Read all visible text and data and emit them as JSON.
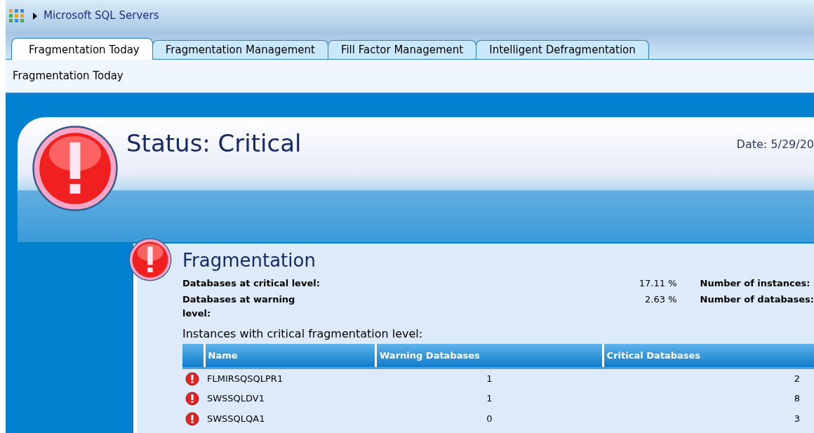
{
  "breadcrumb": {
    "title": "Microsoft SQL Servers"
  },
  "tabs": [
    {
      "label": "Fragmentation Today",
      "selected": true
    },
    {
      "label": "Fragmentation Management",
      "selected": false
    },
    {
      "label": "Fill Factor Management",
      "selected": false
    },
    {
      "label": "Intelligent Defragmentation",
      "selected": false
    }
  ],
  "page_title": "Fragmentation Today",
  "status": {
    "title": "Status: Critical",
    "date": "Date: 5/29/20"
  },
  "fragmentation": {
    "title": "Fragmentation",
    "stats": [
      {
        "label": "Databases at critical level:",
        "value": "17.11 %",
        "label_2": "Number of instances:"
      },
      {
        "label": "Databases at warning level:",
        "value": "2.63 %",
        "label_2": "Number of databases:"
      }
    ],
    "table_caption": "Instances with critical fragmentation level:",
    "table": {
      "columns": [
        "Name",
        "Warning Databases",
        "Critical Databases"
      ],
      "rows": [
        {
          "name": "FLMIRSQSQLPR1",
          "warning": "1",
          "critical": "2"
        },
        {
          "name": "SWSSQLDV1",
          "warning": "1",
          "critical": "8"
        },
        {
          "name": "SWSSQLQA1",
          "warning": "0",
          "critical": "3"
        }
      ]
    }
  }
}
